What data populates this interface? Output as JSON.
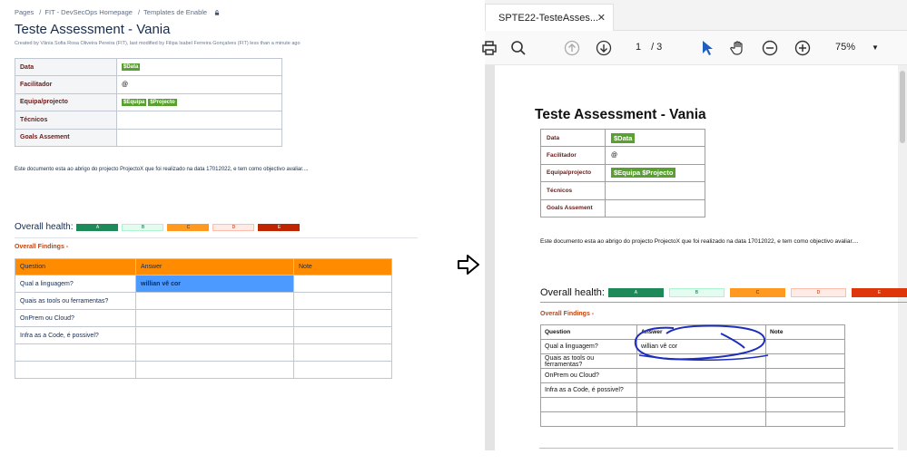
{
  "confluence": {
    "breadcrumb": [
      "Pages",
      "FIT - DevSecOps Homepage",
      "Templates de Enable"
    ],
    "breadcrumb_sep": "/",
    "title": "Teste Assessment - Vania",
    "byline": "Created by Vânia Sofia Rosa Oliveira Pereira (FIT), last modified by Filipa Isabel Ferreira Gonçalves (FIT) less than a minute ago",
    "meta": {
      "data_label": "Data",
      "data_value": "$Data",
      "facilitador_label": "Facilitador",
      "facilitador_value": "@",
      "equipa_label": "Equipa/projecto",
      "equipa_value": "$Equipa",
      "projecto_value": "$Projecto",
      "tecnicos_label": "Técnicos",
      "goals_label": "Goals Assement"
    },
    "paragraph": "Este documento esta ao abrigo do projecto  ProjectoX  que foi realizado na data 17012022, e tem como objectivo avaliar....",
    "health_label": "Overall health:",
    "health": [
      "A",
      "B",
      "C",
      "D",
      "E"
    ],
    "findings_label": "Overall Findings -",
    "table": {
      "headers": [
        "Question",
        "Answer",
        "Note"
      ],
      "rows": [
        [
          "Qual a linguagem?",
          "willian vê cor",
          ""
        ],
        [
          "Quais as tools ou ferramentas?",
          "",
          ""
        ],
        [
          "OnPrem ou Cloud?",
          "",
          ""
        ],
        [
          "Infra as a Code, é possivel?",
          "",
          ""
        ],
        [
          "",
          "",
          ""
        ],
        [
          "",
          "",
          ""
        ]
      ]
    }
  },
  "pdf": {
    "tab_title": "SPTE22-TesteAsses...",
    "tab_close": "✕",
    "page_current": "1",
    "page_total": "/ 3",
    "zoom": "75%",
    "title": "Teste Assessment - Vania",
    "meta": {
      "data_label": "Data",
      "data_value": "$Data",
      "facilitador_label": "Facilitador",
      "facilitador_value": "@",
      "equipa_label": "Equipa/projecto",
      "equipa_value": "$Equipa  $Projecto",
      "tecnicos_label": "Técnicos",
      "goals_label": "Goals Assement"
    },
    "paragraph": "Este documento esta ao abrigo do projecto  ProjectoX  que foi realizado na data 17012022, e tem como objectivo avaliar....",
    "health_label": "Overall health:",
    "health": [
      "A",
      "B",
      "C",
      "D",
      "E"
    ],
    "findings_label": "Overall Findings -",
    "table": {
      "headers": [
        "Question",
        "Answer",
        "Note"
      ],
      "rows": [
        [
          "Qual a linguagem?",
          "willian vê cor",
          ""
        ],
        [
          "Quais as tools ou ferramentas?",
          "",
          ""
        ],
        [
          "OnPrem ou Cloud?",
          "",
          ""
        ],
        [
          "Infra as a Code, é possivel?",
          "",
          ""
        ],
        [
          "",
          "",
          ""
        ],
        [
          "",
          "",
          ""
        ]
      ]
    }
  },
  "colors": {
    "health_a": "#1e8a5a",
    "health_b": "#e3fcef",
    "health_c": "#ff991f",
    "health_d": "#ffebe6",
    "health_e": "#bf2600",
    "header_orange": "#ff8b00",
    "selection_blue": "#4c9aff",
    "lozenge_green": "#59a030",
    "scribble": "#1f2dbd"
  },
  "icons": [
    "lock-icon",
    "arrow-right-outline-icon",
    "print-icon",
    "search-icon",
    "page-up-icon",
    "page-down-icon",
    "select-cursor-icon",
    "hand-icon",
    "zoom-out-icon",
    "zoom-in-icon",
    "chevron-down-icon"
  ]
}
